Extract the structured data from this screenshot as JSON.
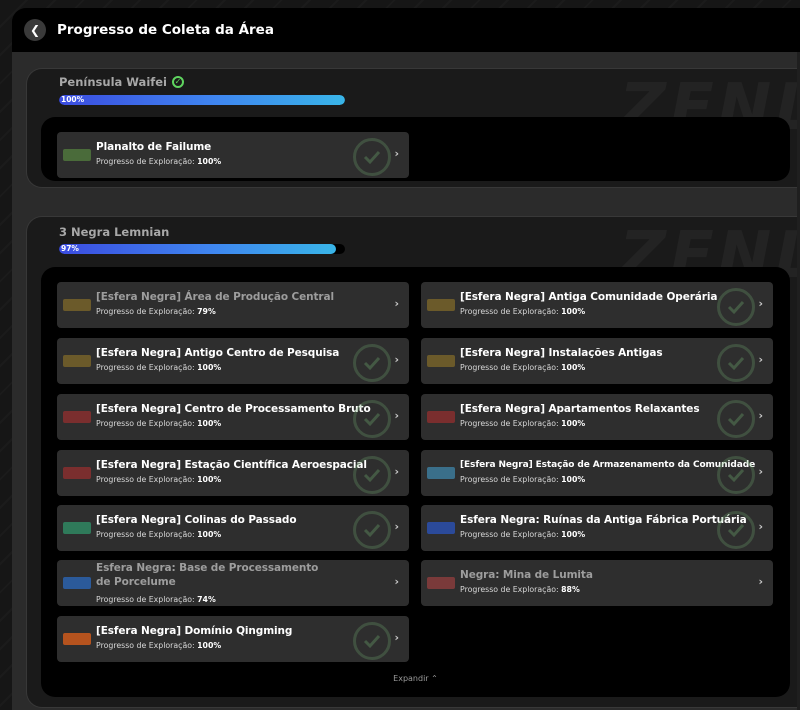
{
  "header": {
    "title": "Progresso de Coleta da Área"
  },
  "watermark": "ZENL",
  "regions": [
    {
      "name": "Península Waifei",
      "progress_label": "100%",
      "progress": 1.0,
      "completed": true,
      "areas": [
        {
          "title": "Planalto de Failume",
          "sub_label": "Progresso de Exploração:",
          "value": "100%",
          "complete": true,
          "thumb_color": "#4a6b3a"
        }
      ]
    },
    {
      "name": "3 Negra Lemnian",
      "progress_label": "97%",
      "progress": 0.97,
      "completed": false,
      "expand_label": "Expandir",
      "areas": [
        {
          "title": "[Esfera Negra] Área de Produção Central",
          "sub_label": "Progresso de Exploração:",
          "value": "79%",
          "complete": false,
          "dim": true,
          "thumb_color": "#6b5a2a"
        },
        {
          "title": "[Esfera Negra] Antiga Comunidade Operária",
          "sub_label": "Progresso de Exploração:",
          "value": "100%",
          "complete": true,
          "thumb_color": "#6b5a2a"
        },
        {
          "title": "[Esfera Negra] Antigo Centro de Pesquisa",
          "sub_label": "Progresso de Exploração:",
          "value": "100%",
          "complete": true,
          "thumb_color": "#6b5a2a"
        },
        {
          "title": "[Esfera Negra] Instalações Antigas",
          "sub_label": "Progresso de Exploração:",
          "value": "100%",
          "complete": true,
          "thumb_color": "#6b5a2a"
        },
        {
          "title": "[Esfera Negra] Centro de Processamento Bruto",
          "sub_label": "Progresso de Exploração:",
          "value": "100%",
          "complete": true,
          "thumb_color": "#7a2e2e"
        },
        {
          "title": "[Esfera Negra] Apartamentos Relaxantes",
          "sub_label": "Progresso de Exploração:",
          "value": "100%",
          "complete": true,
          "thumb_color": "#7a2e2e"
        },
        {
          "title": "[Esfera Negra] Estação Científica Aeroespacial",
          "sub_label": "Progresso de Exploração:",
          "value": "100%",
          "complete": true,
          "thumb_color": "#7a2e2e"
        },
        {
          "title": "[Esfera Negra] Estação de Armazenamento da Comunidade",
          "sub_label": "Progresso de Exploração:",
          "value": "100%",
          "complete": true,
          "small": true,
          "thumb_color": "#3a6f8a"
        },
        {
          "title": "[Esfera Negra] Colinas do Passado",
          "sub_label": "Progresso de Exploração:",
          "value": "100%",
          "complete": true,
          "thumb_color": "#2f7a5a"
        },
        {
          "title": "Esfera Negra: Ruínas da Antiga Fábrica Portuária",
          "sub_label": "Progresso de Exploração:",
          "value": "100%",
          "complete": true,
          "thumb_color": "#2b4a9a"
        },
        {
          "title": "Esfera Negra: Base de Processamento de Porcelume",
          "sub_label": "Progresso de Exploração:",
          "value": "74%",
          "complete": false,
          "dim": true,
          "wrap": true,
          "thumb_color": "#2b5a9a"
        },
        {
          "title": "Negra: Mina de Lumita",
          "sub_label": "Progresso de Exploração:",
          "value": "88%",
          "complete": false,
          "dim": true,
          "thumb_color": "#7a3a3a"
        },
        {
          "title": "[Esfera Negra] Domínio Qingming",
          "sub_label": "Progresso de Exploração:",
          "value": "100%",
          "complete": true,
          "thumb_color": "#b5531e"
        }
      ]
    }
  ]
}
